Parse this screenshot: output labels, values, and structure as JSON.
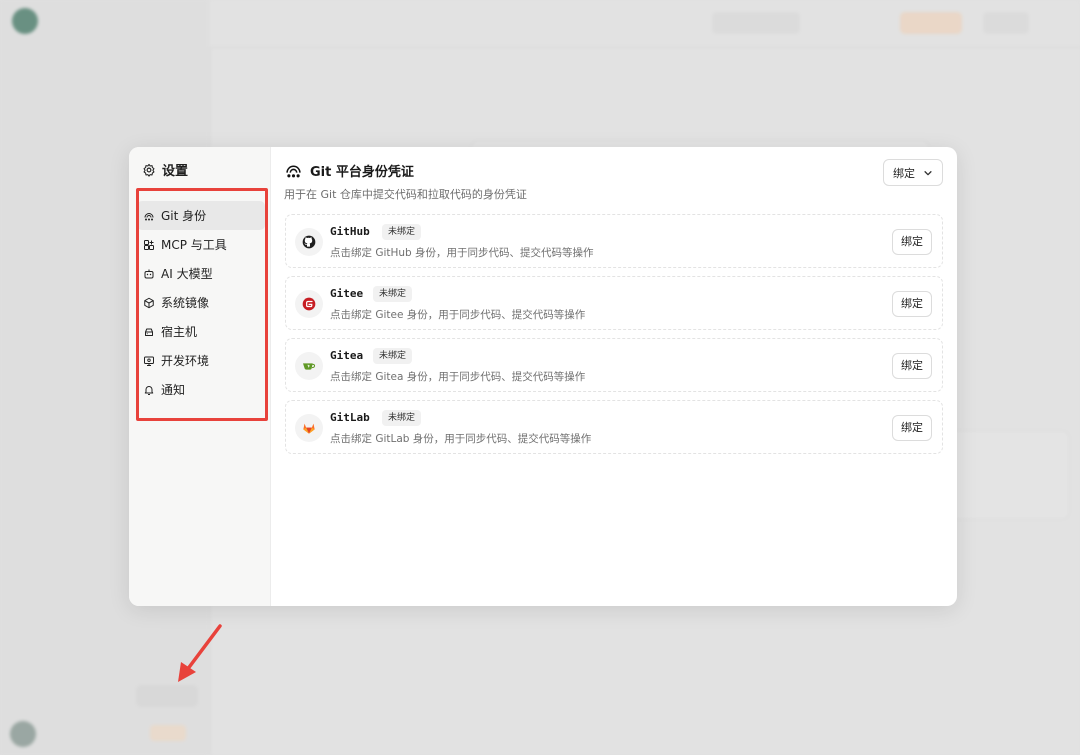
{
  "settings": {
    "title": "设置",
    "nav": [
      {
        "label": "Git 身份",
        "icon": "git-identity-icon",
        "active": true
      },
      {
        "label": "MCP 与工具",
        "icon": "tools-icon",
        "active": false
      },
      {
        "label": "AI 大模型",
        "icon": "robot-icon",
        "active": false
      },
      {
        "label": "系统镜像",
        "icon": "cube-icon",
        "active": false
      },
      {
        "label": "宿主机",
        "icon": "server-icon",
        "active": false
      },
      {
        "label": "开发环境",
        "icon": "monitor-icon",
        "active": false
      },
      {
        "label": "通知",
        "icon": "bell-icon",
        "active": false
      }
    ]
  },
  "content": {
    "title": "Git 平台身份凭证",
    "description": "用于在 Git 仓库中提交代码和拉取代码的身份凭证",
    "bind_dropdown": "绑定",
    "providers": [
      {
        "name": "GitHub",
        "status": "未绑定",
        "description": "点击绑定 GitHub 身份，用于同步代码、提交代码等操作",
        "button": "绑定",
        "icon": "github-icon",
        "color": "#1f1f1f"
      },
      {
        "name": "Gitee",
        "status": "未绑定",
        "description": "点击绑定 Gitee 身份，用于同步代码、提交代码等操作",
        "button": "绑定",
        "icon": "gitee-icon",
        "color": "#c71d23"
      },
      {
        "name": "Gitea",
        "status": "未绑定",
        "description": "点击绑定 Gitea 身份，用于同步代码、提交代码等操作",
        "button": "绑定",
        "icon": "gitea-icon",
        "color": "#609926"
      },
      {
        "name": "GitLab",
        "status": "未绑定",
        "description": "点击绑定 GitLab 身份，用于同步代码、提交代码等操作",
        "button": "绑定",
        "icon": "gitlab-icon",
        "color": "#fc6d26"
      }
    ]
  },
  "annotation": {
    "highlight_color": "#e8423b"
  }
}
